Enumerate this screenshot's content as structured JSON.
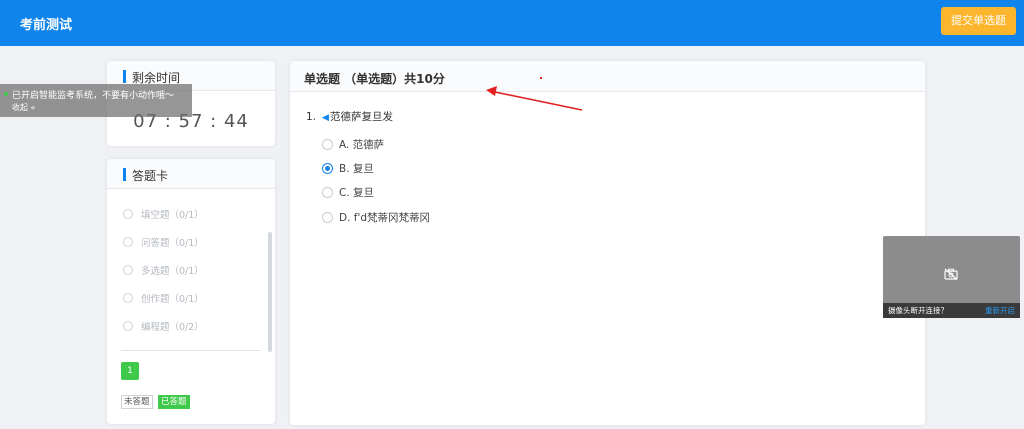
{
  "header": {
    "title": "考前测试",
    "submit_label": "提交单选题"
  },
  "timer": {
    "label": "剩余时间",
    "value": "07 : 57 : 44"
  },
  "monitor": {
    "message": "已开启智能监考系统，不要有小动作哦～",
    "collapse": "收起 «"
  },
  "answer_card": {
    "label": "答题卡",
    "items": [
      "填空题（0/1）",
      "问答题（0/1）",
      "多选题（0/1）",
      "创作题（0/1）",
      "编程题（0/2）"
    ],
    "current_number": "1",
    "legend_unanswered": "未答题",
    "legend_answered": "已答题"
  },
  "question": {
    "header": "单选题  （单选题）共10分",
    "number": "1.",
    "stem": "范德萨复旦发",
    "options": [
      {
        "label": "A.  范德萨",
        "checked": false
      },
      {
        "label": "B.  复旦",
        "checked": true
      },
      {
        "label": "C.  复旦",
        "checked": false
      },
      {
        "label": "D.  f'd梵蒂冈梵蒂冈",
        "checked": false
      }
    ]
  },
  "camera": {
    "status": "摄像头断开连接？",
    "restart": "重新开启"
  },
  "colors": {
    "primary": "#0e84ec",
    "accent": "#fbb62e",
    "success": "#3fc94a",
    "annotation": "#e22222"
  }
}
